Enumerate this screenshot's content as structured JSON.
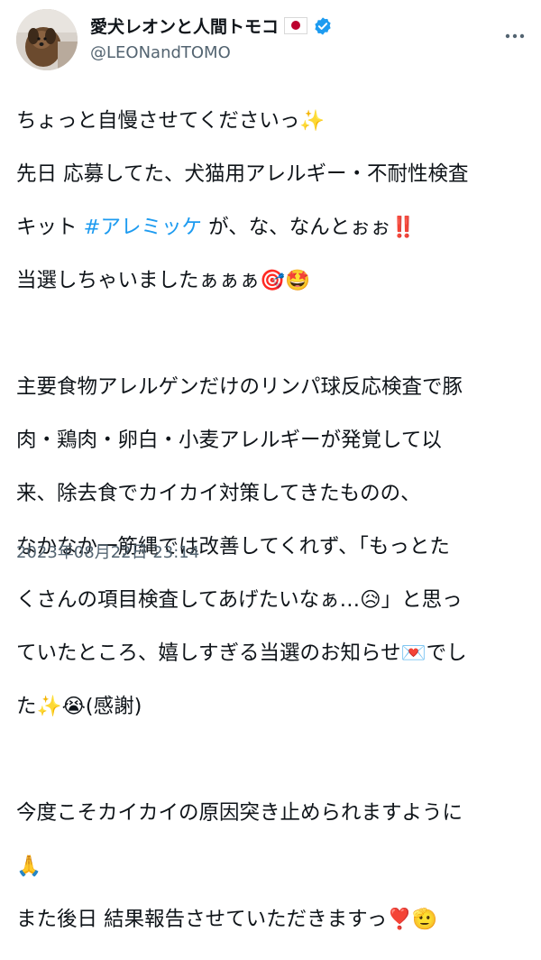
{
  "author": {
    "name": "愛犬レオンと人間トモコ",
    "handle": "@LEONandTOMO"
  },
  "tweet": {
    "lines": [
      "ちょっと自慢させてくださいっ✨",
      "先日 応募してた、犬猫用アレルギー・不耐性検査",
      "キット ",
      "当選しちゃいましたぁぁぁ🎯🤩",
      "",
      "主要食物アレルゲンだけのリンパ球反応検査で豚",
      "肉・鶏肉・卵白・小麦アレルギーが発覚して以",
      "来、除去食でカイカイ対策してきたものの、",
      "なかなか一筋縄では改善してくれず、「もっとた",
      "くさんの項目検査してあげたいなぁ…😥」と思っ",
      "ていたところ、嬉しすぎる当選のお知らせ💌でし",
      "た✨😭(感謝)",
      "",
      "今度こそカイカイの原因突き止められますように",
      "🙏",
      "また後日 結果報告させていただきますっ❣️🫡"
    ],
    "hashtag": "#アレミッケ",
    "after_hashtag": " が、な、なんとぉぉ‼️"
  },
  "timestamp": "2023年08月22日 23:14"
}
